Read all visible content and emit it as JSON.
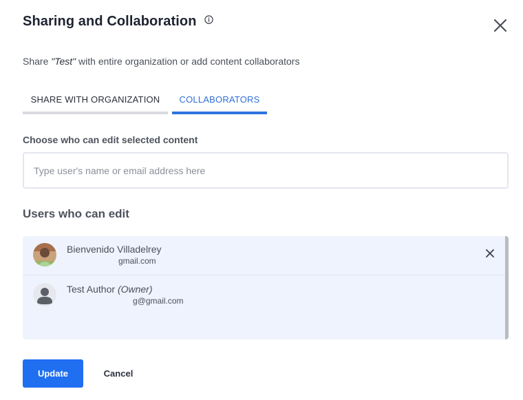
{
  "dialog": {
    "title": "Sharing and Collaboration",
    "subtitle_prefix": "Share ",
    "content_name": "\"Test\"",
    "subtitle_suffix": " with entire organization or add content collaborators"
  },
  "tabs": [
    {
      "label": "SHARE WITH ORGANIZATION",
      "active": false
    },
    {
      "label": "COLLABORATORS",
      "active": true
    }
  ],
  "editor_field": {
    "label": "Choose who can edit selected content",
    "placeholder": "Type user's name or email address here",
    "value": ""
  },
  "users_section": {
    "heading": "Users who can edit",
    "users": [
      {
        "name": "Bienvenido Villadelrey",
        "role": "",
        "email": "gmail.com",
        "removable": true
      },
      {
        "name": "Test Author",
        "role": "(Owner)",
        "email": "g@gmail.com",
        "removable": false
      }
    ]
  },
  "actions": {
    "update_label": "Update",
    "cancel_label": "Cancel"
  },
  "icons": {
    "info": "info-icon",
    "close": "close-icon",
    "remove": "remove-user-icon",
    "default_avatar": "user-silhouette-icon"
  },
  "colors": {
    "accent": "#1f6ff0",
    "active_tab": "#2f6fd8",
    "list_bg": "#eef3fd"
  }
}
